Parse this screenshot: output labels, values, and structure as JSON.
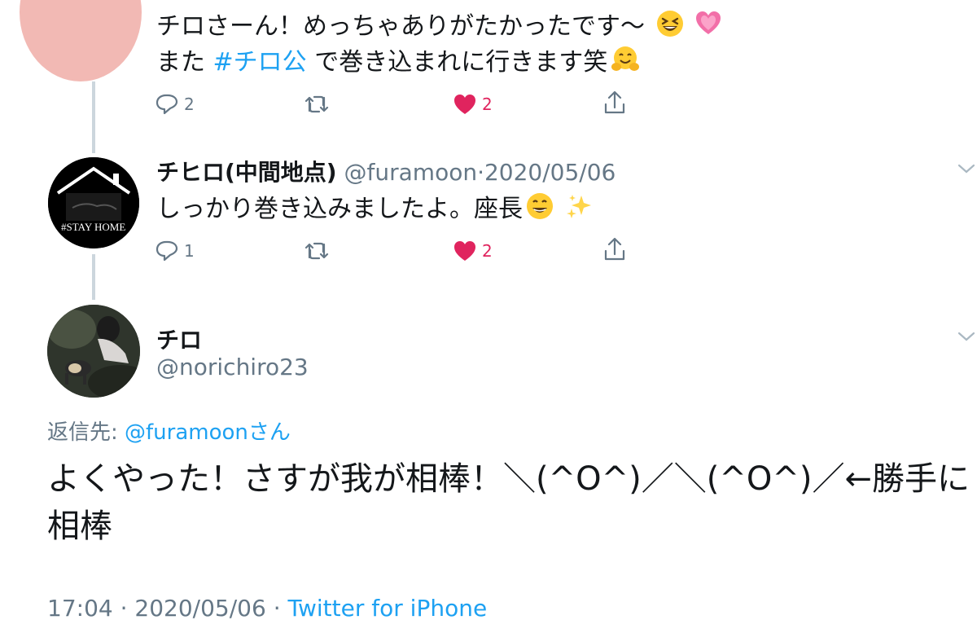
{
  "tweet1": {
    "line1": "チロさーん！めっちゃありがたかったです〜",
    "line2_pre": "また",
    "line2_hashtag": "#チロ公",
    "line2_post": "で巻き込まれに行きます笑",
    "reply_count": "2",
    "like_count": "2"
  },
  "tweet2": {
    "name": "チヒロ(中間地点)",
    "handle": "@furamoon",
    "sep": "·",
    "date": "2020/05/06",
    "avatar_caption": "#STAY HOME",
    "text": "しっかり巻き込みましたよ。座長",
    "reply_count": "1",
    "like_count": "2"
  },
  "main_tweet": {
    "name": "チロ",
    "handle": "@norichiro23",
    "reply_label": "返信先:",
    "reply_to": "@furamoonさん",
    "text_line1": "よくやった！さすが我が相棒！＼(^O^)／＼(^O^)／←勝手に",
    "text_line2": "相棒",
    "time": "17:04",
    "sep": "·",
    "date": "2020/05/06",
    "sep2": "·",
    "source": "Twitter for iPhone"
  },
  "icons": [
    "reply-icon",
    "retweet-icon",
    "like-icon",
    "share-icon",
    "chevron-down-icon",
    "grin-squint-emoji",
    "heart-emoji",
    "hugging-emoji",
    "grin-emoji",
    "sparkles-emoji"
  ],
  "colors": {
    "link": "#1da1f2",
    "like": "#e0245e",
    "muted": "#657786",
    "thread": "#ccd6dd"
  }
}
